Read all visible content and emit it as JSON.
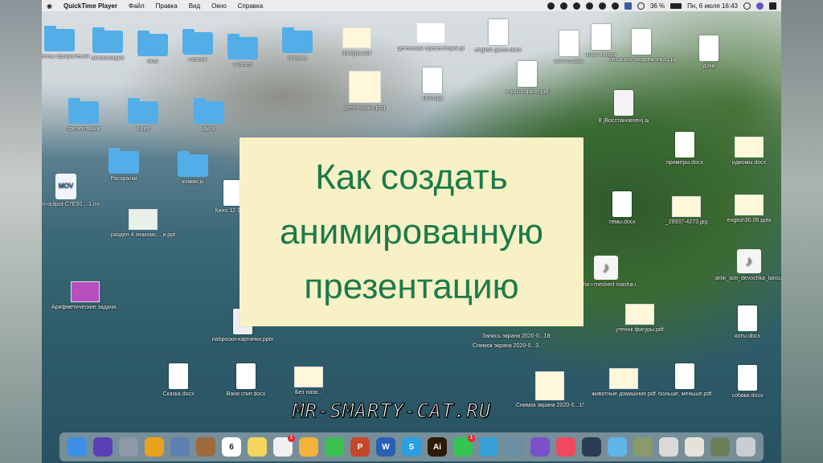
{
  "menubar": {
    "apple": "",
    "app_name": "QuickTime Player",
    "items": [
      "Файл",
      "Правка",
      "Вид",
      "Окно",
      "Справка"
    ],
    "battery": "36 %",
    "datetime": "Пн, 6 июля  16:43"
  },
  "title_card": {
    "line1": "Как создать",
    "line2": "анимированную",
    "line3": "презентацию"
  },
  "watermark": "MR-SMARTY-CAT.RU",
  "desktop_icons": [
    {
      "label": "Шаблоны оформления",
      "kind": "folder"
    },
    {
      "label": "активизация",
      "kind": "folder"
    },
    {
      "label": "сказ",
      "kind": "folder"
    },
    {
      "label": "Разное",
      "kind": "folder"
    },
    {
      "label": "Сканер",
      "kind": "folder"
    },
    {
      "label": "письма",
      "kind": "folder"
    },
    {
      "label": "презентации",
      "kind": "folder"
    },
    {
      "label": "video",
      "kind": "folder"
    },
    {
      "label": "диск",
      "kind": "folder"
    },
    {
      "label": "Раскраски",
      "kind": "folder"
    },
    {
      "label": "комиксы",
      "kind": "folder"
    },
    {
      "label": "фигуры.pdf",
      "kind": "thumb"
    },
    {
      "label": "детеныши презентация.pdf",
      "kind": "doc"
    },
    {
      "label": "english game.docx",
      "kind": "doc"
    },
    {
      "label": "Doc76.docx",
      "kind": "doc"
    },
    {
      "label": "Doc74.docx",
      "kind": "doc"
    },
    {
      "label": "в поисках медвежонка1.pdf",
      "kind": "doc"
    },
    {
      "label": "доки",
      "kind": "doc"
    },
    {
      "label": "детеныши1.png",
      "kind": "thumb"
    },
    {
      "label": "1926.jpg",
      "kind": "doc"
    },
    {
      "label": "english game.pdf",
      "kind": "doc"
    },
    {
      "label": "8 [Восстановлен].ai",
      "kind": "doc"
    },
    {
      "label": "video-output-C7E50....1.mov",
      "kind": "mov"
    },
    {
      "label": "примеры.docx",
      "kind": "doc"
    },
    {
      "label": "идиомы.docx",
      "kind": "thumb"
    },
    {
      "label": "Кино 12 17.59",
      "kind": "doc"
    },
    {
      "label": "раздел 4 знакомс....и.ppt",
      "kind": "thumb"
    },
    {
      "label": "темы.docx",
      "kind": "doc"
    },
    {
      "label": "_29937-4273.jpg",
      "kind": "thumb"
    },
    {
      "label": "english30.06.pptx",
      "kind": "thumb"
    },
    {
      "label": "masha-i-medved-masha-i....i.mp3",
      "kind": "music"
    },
    {
      "label": "artik_asti_devochka_tancuj....om.mp3",
      "kind": "music"
    },
    {
      "label": "Арифметические задачи....stok.pps",
      "kind": "thumb"
    },
    {
      "label": "Снимок экрана 2020-0...3.mov",
      "kind": "doc"
    },
    {
      "label": "Запись экрана 2020-0...18.21.00",
      "kind": "doc"
    },
    {
      "label": "утенок фигуры.pdf",
      "kind": "thumb"
    },
    {
      "label": "коты.docx",
      "kind": "doc"
    },
    {
      "label": "наброски-картинки.pptx",
      "kind": "doc"
    },
    {
      "label": "Сказка.docx",
      "kind": "doc"
    },
    {
      "label": "Ваня спит.docx",
      "kind": "doc"
    },
    {
      "label": "Без назв...",
      "kind": "thumb"
    },
    {
      "label": "Снимок экрана 2020-0...15.20.35",
      "kind": "thumb"
    },
    {
      "label": "животные домашние.pdf",
      "kind": "thumb"
    },
    {
      "label": "больше, меньше.pdf",
      "kind": "doc"
    },
    {
      "label": "собаки.docx",
      "kind": "doc"
    }
  ],
  "dock": {
    "items": [
      {
        "name": "finder",
        "label": "",
        "color": "#3b8fe4"
      },
      {
        "name": "siri",
        "label": "",
        "color": "#5a3fb5"
      },
      {
        "name": "launchpad",
        "label": "",
        "color": "#8d99a6"
      },
      {
        "name": "chrome",
        "label": "",
        "color": "#e8a21e"
      },
      {
        "name": "preview",
        "label": "",
        "color": "#5d7fb1"
      },
      {
        "name": "notes-brown",
        "label": "",
        "color": "#9c6a3b"
      },
      {
        "name": "calendar",
        "label": "6",
        "color": "#ffffff"
      },
      {
        "name": "notes",
        "label": "",
        "color": "#f3d55f"
      },
      {
        "name": "reminders",
        "label": "",
        "color": "#f0f0f0"
      },
      {
        "name": "photos",
        "label": "",
        "color": "#f4b23a"
      },
      {
        "name": "messages",
        "label": "",
        "color": "#3bbf4e"
      },
      {
        "name": "powerpoint",
        "label": "P",
        "color": "#c6452b"
      },
      {
        "name": "word",
        "label": "W",
        "color": "#2b5fb3"
      },
      {
        "name": "skype",
        "label": "S",
        "color": "#2b9fe0"
      },
      {
        "name": "illustrator",
        "label": "Ai",
        "color": "#2f1a05"
      },
      {
        "name": "whatsapp",
        "label": "",
        "color": "#35c552"
      },
      {
        "name": "telegram",
        "label": "",
        "color": "#36a0d9"
      },
      {
        "name": "image-capture",
        "label": "",
        "color": "#6b8ea5"
      },
      {
        "name": "viber",
        "label": "",
        "color": "#7a51c9"
      },
      {
        "name": "music",
        "label": "",
        "color": "#f0485f"
      },
      {
        "name": "quicktime",
        "label": "",
        "color": "#2a3b52"
      },
      {
        "name": "downloads-folder",
        "label": "",
        "color": "#5fb6ea"
      },
      {
        "name": "stack-1",
        "label": "",
        "color": "#8a9a6a"
      },
      {
        "name": "stack-2",
        "label": "",
        "color": "#d9d9d9"
      },
      {
        "name": "stack-3",
        "label": "",
        "color": "#e7e2d8"
      },
      {
        "name": "stack-4",
        "label": "",
        "color": "#6d7f5a"
      },
      {
        "name": "trash",
        "label": "",
        "color": "#c9ced3"
      }
    ],
    "reminders_badge": "1",
    "whatsapp_badge": "1"
  }
}
